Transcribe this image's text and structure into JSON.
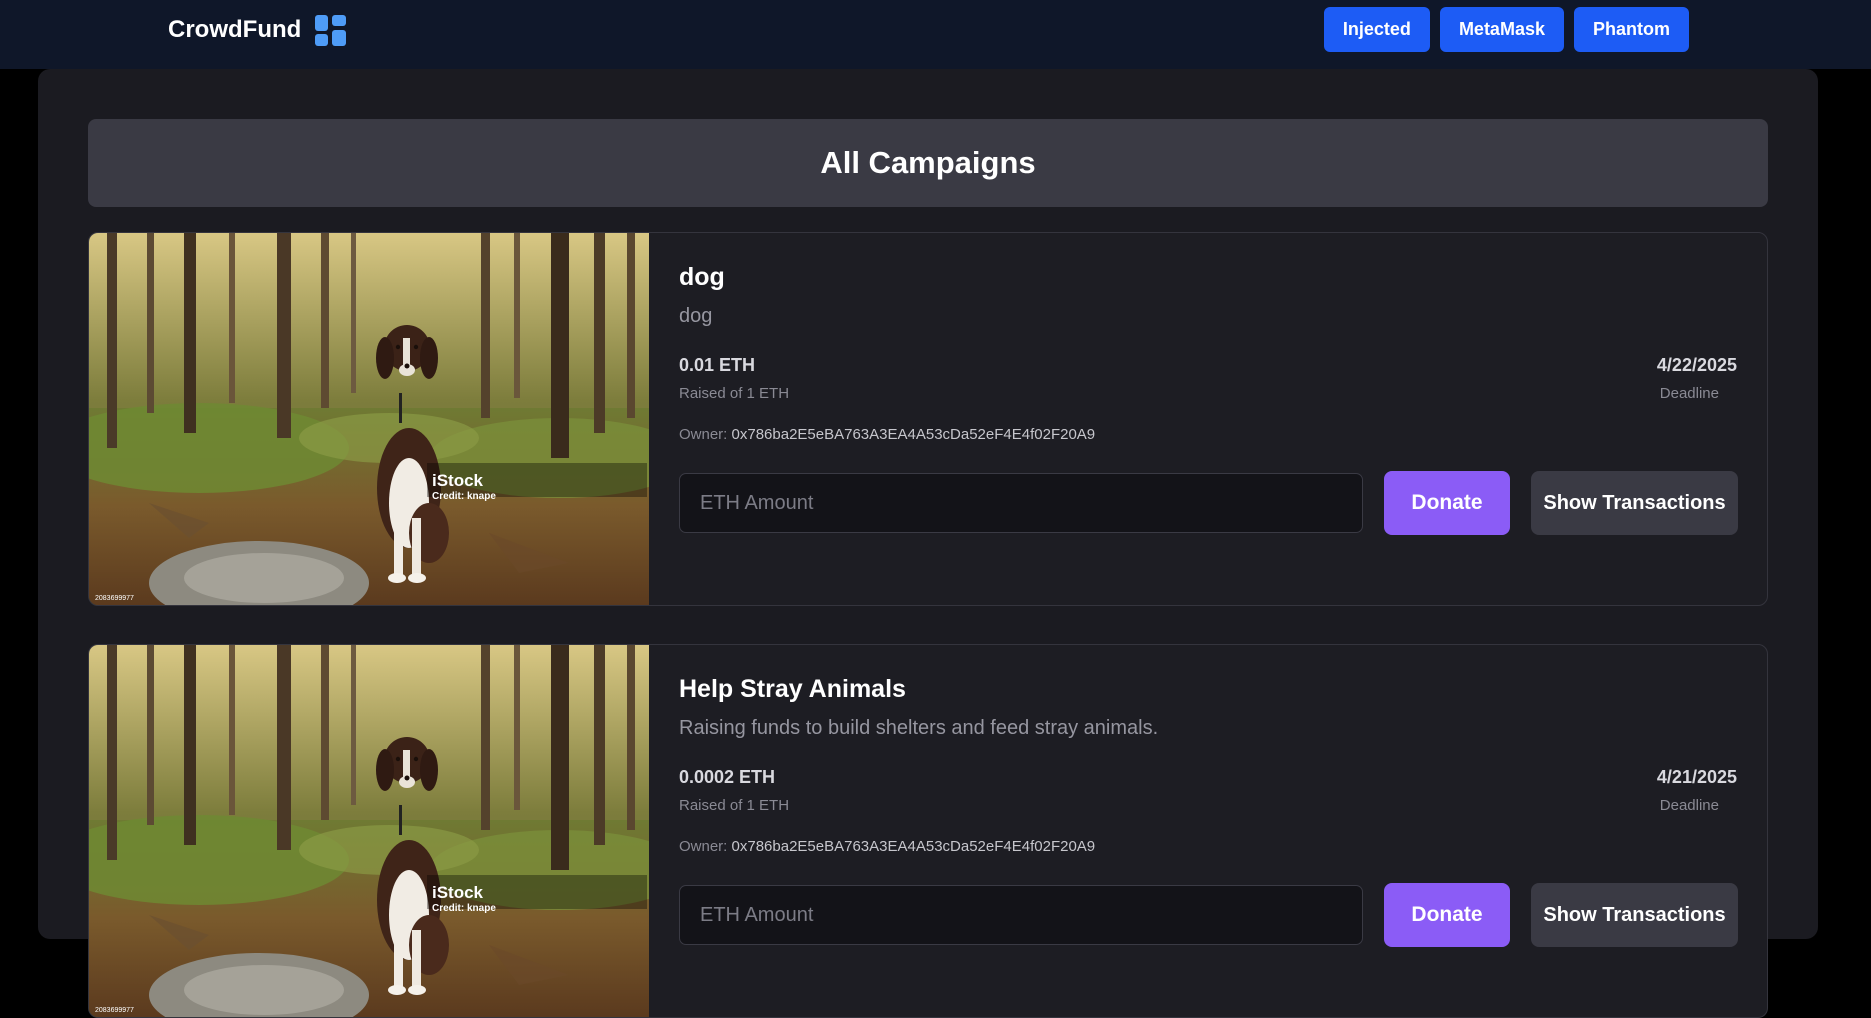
{
  "header": {
    "brand": "CrowdFund",
    "brand_icon": "grid-icon",
    "accent_color": "#1d5cf5",
    "wallets": [
      "Injected",
      "MetaMask",
      "Phantom"
    ]
  },
  "page": {
    "title": "All Campaigns"
  },
  "campaigns": [
    {
      "image": {
        "watermark": "iStock",
        "credit": "Credit: knape",
        "stock_id": "2083699977"
      },
      "title": "dog",
      "description": "dog",
      "raised": "0.01 ETH",
      "raised_label": "Raised of 1 ETH",
      "deadline": "4/22/2025",
      "deadline_label": "Deadline",
      "owner_label": "Owner:",
      "owner": "0x786ba2E5eBA763A3EA4A53cDa52eF4E4f02F20A9",
      "amount_placeholder": "ETH Amount",
      "donate_label": "Donate",
      "transactions_label": "Show Transactions"
    },
    {
      "image": {
        "watermark": "iStock",
        "credit": "Credit: knape",
        "stock_id": "2083699977"
      },
      "title": "Help Stray Animals",
      "description": "Raising funds to build shelters and feed stray animals.",
      "raised": "0.0002 ETH",
      "raised_label": "Raised of 1 ETH",
      "deadline": "4/21/2025",
      "deadline_label": "Deadline",
      "owner_label": "Owner:",
      "owner": "0x786ba2E5eBA763A3EA4A53cDa52eF4E4f02F20A9",
      "amount_placeholder": "ETH Amount",
      "donate_label": "Donate",
      "transactions_label": "Show Transactions"
    }
  ]
}
